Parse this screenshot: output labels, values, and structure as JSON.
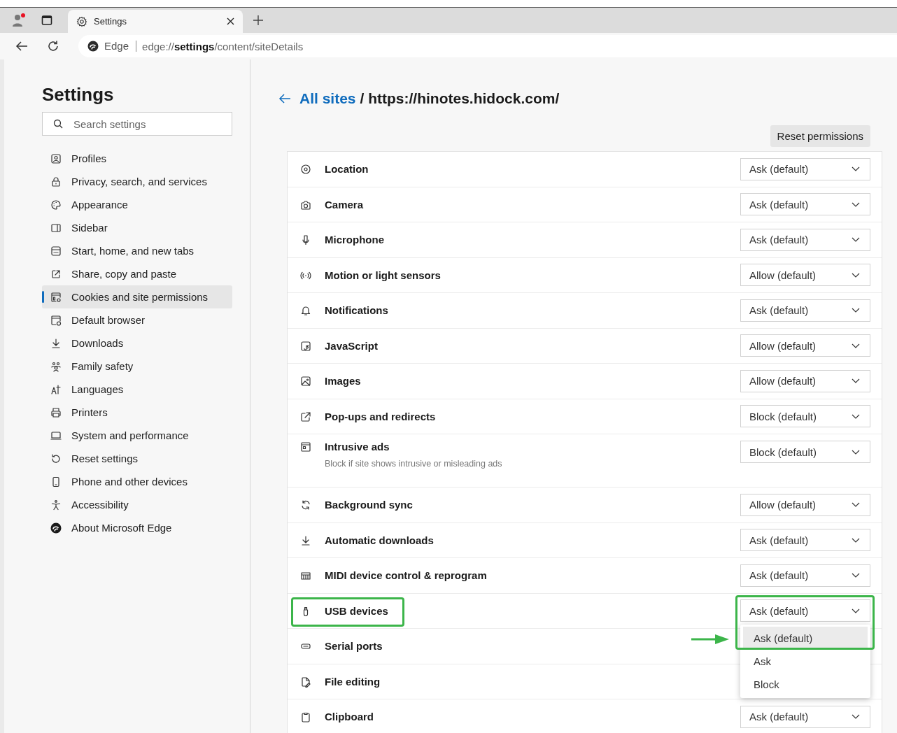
{
  "browser": {
    "tab": {
      "title": "Settings",
      "selected": true
    },
    "address": {
      "site": "Edge",
      "url": "edge://**settings**/content/siteDetails"
    }
  },
  "sidebar": {
    "title": "Settings",
    "search": {
      "placeholder": "Search settings"
    },
    "items": [
      {
        "label": "Profiles",
        "selected": false
      },
      {
        "label": "Privacy, search, and services",
        "selected": false
      },
      {
        "label": "Appearance",
        "selected": false
      },
      {
        "label": "Sidebar",
        "selected": false
      },
      {
        "label": "Start, home, and new tabs",
        "selected": false
      },
      {
        "label": "Share, copy and paste",
        "selected": false
      },
      {
        "label": "Cookies and site permissions",
        "selected": true
      },
      {
        "label": "Default browser",
        "selected": false
      },
      {
        "label": "Downloads",
        "selected": false
      },
      {
        "label": "Family safety",
        "selected": false
      },
      {
        "label": "Languages",
        "selected": false
      },
      {
        "label": "Printers",
        "selected": false
      },
      {
        "label": "System and performance",
        "selected": false
      },
      {
        "label": "Reset settings",
        "selected": false
      },
      {
        "label": "Phone and other devices",
        "selected": false
      },
      {
        "label": "Accessibility",
        "selected": false
      },
      {
        "label": "About Microsoft Edge",
        "selected": false
      }
    ]
  },
  "breadcrumb": {
    "link": "All sites",
    "rest": "/ https://hinotes.hidock.com/"
  },
  "reset_button": "Reset permissions",
  "permissions": [
    {
      "label": "Location",
      "value": "Ask (default)",
      "highlighted": false
    },
    {
      "label": "Camera",
      "value": "Ask (default)",
      "highlighted": false
    },
    {
      "label": "Microphone",
      "value": "Ask (default)",
      "highlighted": false
    },
    {
      "label": "Motion or light sensors",
      "value": "Allow (default)",
      "highlighted": false
    },
    {
      "label": "Notifications",
      "value": "Ask (default)",
      "highlighted": false
    },
    {
      "label": "JavaScript",
      "value": "Allow (default)",
      "highlighted": false
    },
    {
      "label": "Images",
      "value": "Allow (default)",
      "highlighted": false
    },
    {
      "label": "Pop-ups and redirects",
      "value": "Block (default)",
      "highlighted": false
    },
    {
      "label": "Intrusive ads",
      "description": "Block if site shows intrusive or misleading ads",
      "value": "Block (default)",
      "highlighted": false
    },
    {
      "label": "Background sync",
      "value": "Allow (default)",
      "highlighted": false
    },
    {
      "label": "Automatic downloads",
      "value": "Ask (default)",
      "highlighted": false
    },
    {
      "label": "MIDI device control & reprogram",
      "value": "Ask (default)",
      "highlighted": false
    },
    {
      "label": "USB devices",
      "value": "Ask (default)",
      "highlighted": true,
      "menu": {
        "highlighted": true,
        "options": [
          {
            "label": "Ask (default)",
            "selected": true
          },
          {
            "label": "Ask",
            "selected": false
          },
          {
            "label": "Block",
            "selected": false
          }
        ]
      }
    },
    {
      "label": "Serial ports",
      "highlighted": false
    },
    {
      "label": "File editing",
      "highlighted": false
    },
    {
      "label": "Clipboard",
      "value": "Ask (default)",
      "highlighted": false
    }
  ]
}
